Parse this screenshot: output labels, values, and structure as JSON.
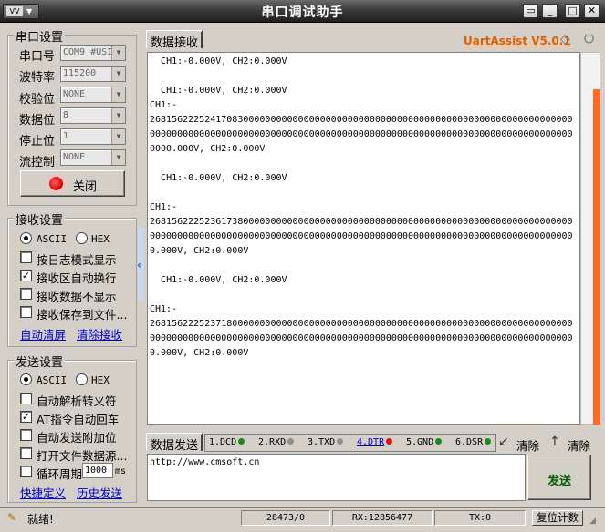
{
  "window": {
    "title": "串口调试助手",
    "sysmenu_logo": "VV",
    "minimize": "▭",
    "maximize": "□",
    "close": "✕"
  },
  "serial": {
    "group_title": "串口设置",
    "port_label": "串口号",
    "port_value": "COM9 #USI",
    "baud_label": "波特率",
    "baud_value": "115200",
    "parity_label": "校验位",
    "parity_value": "NONE",
    "databits_label": "数据位",
    "databits_value": "8",
    "stopbits_label": "停止位",
    "stopbits_value": "1",
    "flow_label": "流控制",
    "flow_value": "NONE",
    "close_button": "关闭"
  },
  "recv_settings": {
    "group_title": "接收设置",
    "ascii": "ASCII",
    "hex": "HEX",
    "mode_selected": "ASCII",
    "log_mode": "按日志模式显示",
    "log_mode_checked": false,
    "auto_wrap": "接收区自动换行",
    "auto_wrap_checked": true,
    "hide_data": "接收数据不显示",
    "hide_data_checked": false,
    "save_file": "接收保存到文件...",
    "save_file_checked": false,
    "auto_clear_link": "自动清屏",
    "clear_recv_link": "清除接收"
  },
  "send_settings": {
    "group_title": "发送设置",
    "ascii": "ASCII",
    "hex": "HEX",
    "mode_selected": "ASCII",
    "parse_escape": "自动解析转义符",
    "parse_escape_checked": false,
    "at_cr": "AT指令自动回车",
    "at_cr_checked": true,
    "append_check": "自动发送附加位",
    "append_check_checked": false,
    "open_file": "打开文件数据源...",
    "open_file_checked": false,
    "cycle": "循环周期",
    "cycle_checked": false,
    "cycle_value": "1000",
    "cycle_unit": "ms",
    "shortcut_link": "快捷定义",
    "history_link": "历史发送"
  },
  "recv": {
    "tab": "数据接收",
    "brand": "UartAssist V5.0.1",
    "text": "  CH1:-0.000V, CH2:0.000V\n\n  CH1:-0.000V, CH2:0.000V\nCH1:-\n26815622252417083000000000000000000000000000000000000000000000000000000000000000000000000000000000000000000000000000000000000000000000000000000000000000000000.000V, CH2:0.000V\n\n  CH1:-0.000V, CH2:0.000V\n\nCH1:-\n26815622252361738000000000000000000000000000000000000000000000000000000000000000000000000000000000000000000000000000000000000000000000000000000000000000000.000V, CH2:0.000V\n\n  CH1:-0.000V, CH2:0.000V\n\nCH1:-\n26815622252371800000000000000000000000000000000000000000000000000000000000000000000000000000000000000000000000000000000000000000000000000000000000000000000.000V, CH2:0.000V"
  },
  "send": {
    "tab": "数据发送",
    "signals": [
      {
        "label": "1.DCD",
        "color": "#1a8a1a"
      },
      {
        "label": "2.RXD",
        "color": "#909090"
      },
      {
        "label": "3.TXD",
        "color": "#909090"
      },
      {
        "label": "4.DTR",
        "color": "#e01010"
      },
      {
        "label": "5.GND",
        "color": "#1a8a1a"
      },
      {
        "label": "6.DSR",
        "color": "#1a8a1a"
      }
    ],
    "clear1": "清除",
    "clear2": "清除",
    "input_value": "http://www.cmsoft.cn",
    "send_button": "发送"
  },
  "statusbar": {
    "ready": "就绪!",
    "counter": "28473/0",
    "rx": "RX:12856477",
    "tx": "TX:0",
    "reset": "复位计数"
  }
}
